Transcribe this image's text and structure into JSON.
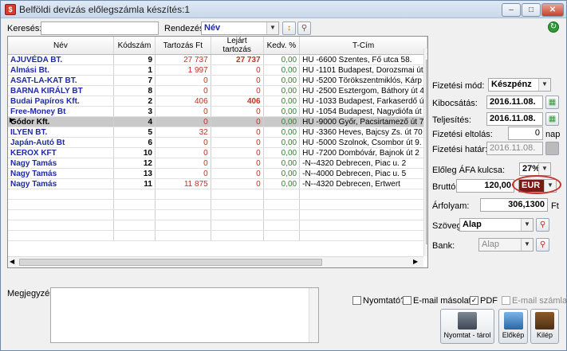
{
  "window": {
    "title": "Belföldi devizás előlegszámla készítés:1",
    "icon_text": "$"
  },
  "search": {
    "label": "Keresés:",
    "value": ""
  },
  "sort": {
    "label": "Rendezés:",
    "value": "Név"
  },
  "table": {
    "headers": [
      "Név",
      "Kódszám",
      "Tartozás Ft",
      "Lejárt tartozás",
      "Kedv. %",
      "T-Cím"
    ],
    "rows": [
      {
        "name": "AJUVÉDA BT.",
        "code": "9",
        "debt": "27 737",
        "overdue": "27 737",
        "disc": "0,00",
        "addr": "HU -6600 Szentes, Fő utca 58."
      },
      {
        "name": "Almási Bt.",
        "code": "1",
        "debt": "1 997",
        "overdue": "0",
        "disc": "0,00",
        "addr": "HU -1101 Budapest, Dorozsmai út"
      },
      {
        "name": "ASAT-LA-KAT BT.",
        "code": "7",
        "debt": "0",
        "overdue": "0",
        "disc": "0,00",
        "addr": "HU -5200 Törökszentmiklós, Kárp"
      },
      {
        "name": "BARNA KIRÁLY BT",
        "code": "8",
        "debt": "0",
        "overdue": "0",
        "disc": "0,00",
        "addr": "HU -2500 Esztergom, Báthory út 4"
      },
      {
        "name": "Budai Papíros Kft.",
        "code": "2",
        "debt": "406",
        "overdue": "406",
        "disc": "0,00",
        "addr": "HU -1033 Budapest, Farkaserdő ú"
      },
      {
        "name": "Free-Money Bt",
        "code": "3",
        "debt": "0",
        "overdue": "0",
        "disc": "0,00",
        "addr": "HU -1054 Budapest, Nagydiófa út"
      },
      {
        "name": "Gódor Kft.",
        "code": "4",
        "debt": "0",
        "overdue": "0",
        "disc": "0,00",
        "addr": "HU -9000 Győr, Pacsirtamező út 7"
      },
      {
        "name": "ILYEN BT.",
        "code": "5",
        "debt": "32",
        "overdue": "0",
        "disc": "0,00",
        "addr": "HU -3360 Heves, Bajcsy Zs. út 70"
      },
      {
        "name": "Japán-Autó Bt",
        "code": "6",
        "debt": "0",
        "overdue": "0",
        "disc": "0,00",
        "addr": "HU -5000 Szolnok, Csombor út 9."
      },
      {
        "name": "KEROX KFT",
        "code": "10",
        "debt": "0",
        "overdue": "0",
        "disc": "0,00",
        "addr": "HU -7200 Dombóvár, Bajnok út 2"
      },
      {
        "name": "Nagy Tamás",
        "code": "12",
        "debt": "0",
        "overdue": "0",
        "disc": "0,00",
        "addr": "-N--4320 Debrecen, Piac u. 2"
      },
      {
        "name": "Nagy Tamás",
        "code": "13",
        "debt": "0",
        "overdue": "0",
        "disc": "0,00",
        "addr": "-N--4000 Debrecen, Piac u. 5"
      },
      {
        "name": "Nagy Tamás",
        "code": "11",
        "debt": "11 875",
        "overdue": "0",
        "disc": "0,00",
        "addr": "-N--4320 Debrecen, Ertwert"
      }
    ],
    "selected_index": 6
  },
  "form": {
    "payment_mode_label": "Fizetési mód:",
    "payment_mode_value": "Készpénz",
    "issue_label": "Kibocsátás:",
    "issue_value": "2016.11.08.",
    "fulfil_label": "Teljesítés:",
    "fulfil_value": "2016.11.08.",
    "deferral_label": "Fizetési eltolás:",
    "deferral_value": "0",
    "deferral_unit": "nap",
    "deadline_label": "Fizetési határ:",
    "deadline_value": "2016.11.08.",
    "vat_label": "Előleg ÁFA kulcsa:",
    "vat_value": "27%",
    "gross_label": "Bruttó:",
    "gross_value": "120,00",
    "currency_value": "EUR",
    "rate_label": "Árfolyam:",
    "rate_value": "306,1300",
    "rate_unit": "Ft",
    "text_label": "Szöveg:",
    "text_value": "Alap",
    "bank_label": "Bank:",
    "bank_value": "Alap"
  },
  "notes": {
    "label": "Megjegyzés:",
    "value": ""
  },
  "options": {
    "print_label": "Nyomtató?",
    "print_checked": false,
    "email_copy_label": "E-mail másolat",
    "email_copy_checked": false,
    "pdf_label": "PDF",
    "pdf_checked": true,
    "email_invoice_label": "E-mail számla",
    "email_invoice_checked": false
  },
  "buttons": {
    "print_store": "Nyomtat - tárol",
    "preview": "Előkép",
    "exit": "Kilép"
  },
  "colors": {
    "link_blue": "#1f2aa8",
    "debt_red": "#c0321f",
    "disc_green": "#238c2c",
    "currency_bg": "#7a1a14"
  },
  "icons": [
    "app-icon",
    "minimize-icon",
    "maximize-icon",
    "close-icon",
    "refresh-icon",
    "sort-direction-icon",
    "filter-icon",
    "printer-icon",
    "floppy-disk-icon",
    "preview-icon",
    "exit-door-icon",
    "calendar-icon"
  ]
}
